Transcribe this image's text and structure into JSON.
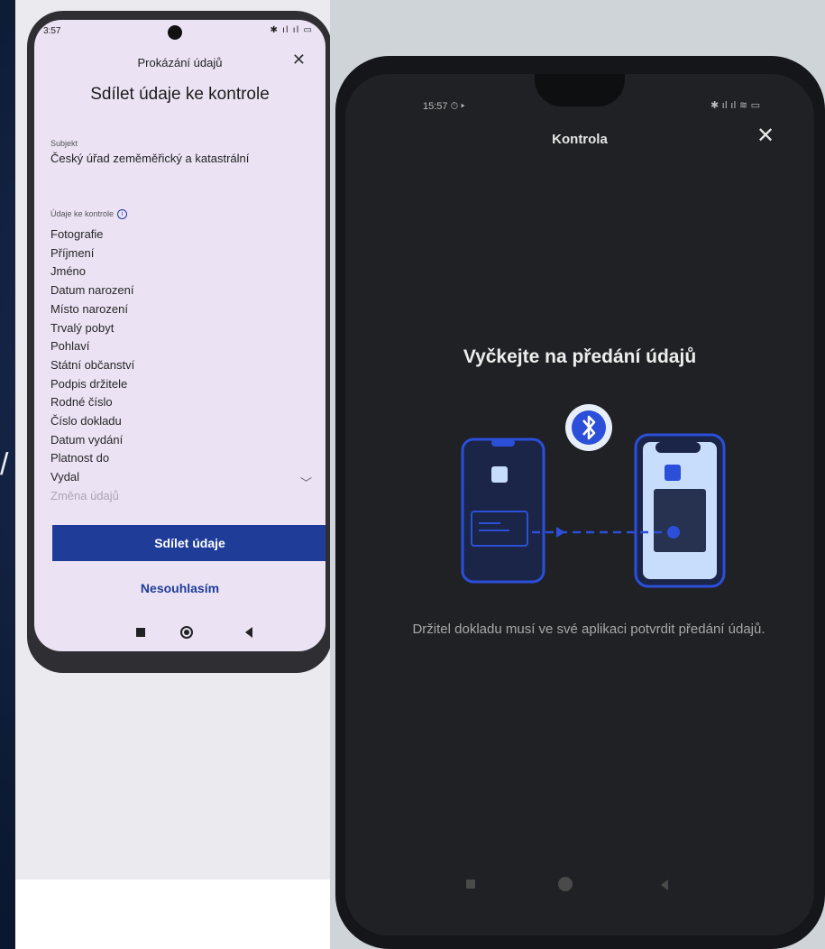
{
  "left_phone": {
    "status": {
      "time": "3:57",
      "icons": "✱ ıl ıl ▭"
    },
    "dialog_title": "Prokázání údajů",
    "heading": "Sdílet údaje ke kontrole",
    "subject_label": "Subjekt",
    "subject_value": "Český úřad zeměměřický a katastrální",
    "list_label": "Údaje ke kontrole",
    "items": [
      "Fotografie",
      "Příjmení",
      "Jméno",
      "Datum narození",
      "Místo narození",
      "Trvalý pobyt",
      "Pohlaví",
      "Státní občanství",
      "Podpis držitele",
      "Rodné číslo",
      "Číslo dokladu",
      "Datum vydání",
      "Platnost do",
      "Vydal",
      "Změna údajů"
    ],
    "share_button": "Sdílet údaje",
    "decline_button": "Nesouhlasím",
    "accent_color": "#1f3c99"
  },
  "right_phone": {
    "status": {
      "time": "15:57 ⏱ ▸",
      "icons": "✱ ıl ıl ≋ ▭"
    },
    "dialog_title": "Kontrola",
    "heading": "Vyčkejte na předání údajů",
    "body_text": "Držitel dokladu musí ve své aplikaci potvrdit předání údajů.",
    "illustration": {
      "bluetooth_icon": "bluetooth-icon",
      "accent_color": "#2b4fd8",
      "light_color": "#c8dcfb"
    }
  }
}
